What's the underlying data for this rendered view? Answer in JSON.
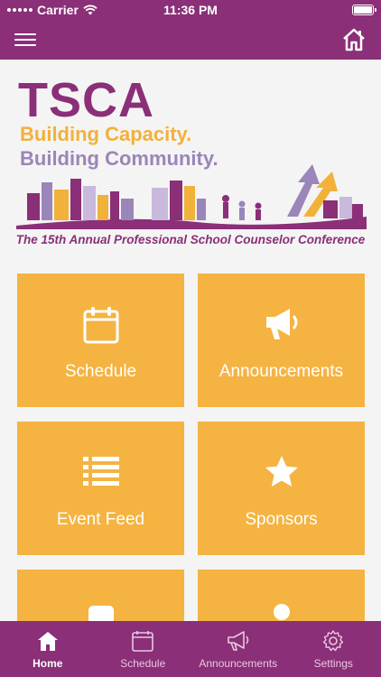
{
  "status_bar": {
    "carrier": "Carrier",
    "time": "11:36 PM"
  },
  "banner": {
    "logo": "TSCA",
    "tagline_1": "Building Capacity.",
    "tagline_2": "Building Community.",
    "subtitle": "The 15th Annual Professional School Counselor Conference"
  },
  "tiles": [
    {
      "label": "Schedule",
      "icon": "calendar-icon"
    },
    {
      "label": "Announcements",
      "icon": "megaphone-icon"
    },
    {
      "label": "Event Feed",
      "icon": "list-icon"
    },
    {
      "label": "Sponsors",
      "icon": "star-icon"
    },
    {
      "label": "",
      "icon": "map-pin-icon"
    },
    {
      "label": "",
      "icon": "person-icon"
    }
  ],
  "tab_bar": {
    "items": [
      {
        "label": "Home",
        "icon": "home-icon",
        "active": true
      },
      {
        "label": "Schedule",
        "icon": "calendar-icon",
        "active": false
      },
      {
        "label": "Announcements",
        "icon": "megaphone-icon",
        "active": false
      },
      {
        "label": "Settings",
        "icon": "gear-icon",
        "active": false
      }
    ]
  },
  "colors": {
    "brand": "#8a2f78",
    "tile": "#f5b342",
    "background": "#f4f4f4"
  }
}
